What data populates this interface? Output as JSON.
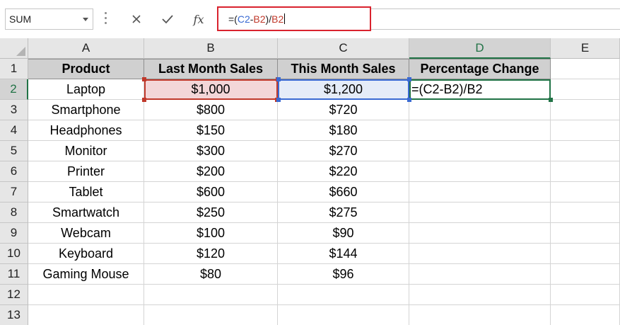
{
  "formula_bar": {
    "name_box": "SUM",
    "cancel_icon": "close-icon",
    "enter_icon": "check-icon",
    "fx_label": "fx",
    "formula_prefix": "=(",
    "formula_ref_c": "C2",
    "formula_minus": "-",
    "formula_ref_b": "B2",
    "formula_mid": ")/",
    "formula_ref_b2": "B2"
  },
  "columns": [
    "A",
    "B",
    "C",
    "D",
    "E"
  ],
  "rows": [
    "1",
    "2",
    "3",
    "4",
    "5",
    "6",
    "7",
    "8",
    "9",
    "10",
    "11",
    "12",
    "13"
  ],
  "headers": [
    "Product",
    "Last Month Sales",
    "This Month Sales",
    "Percentage Change"
  ],
  "data": [
    [
      "Laptop",
      "$1,000",
      "$1,200",
      "=(C2-B2)/B2"
    ],
    [
      "Smartphone",
      "$800",
      "$720",
      ""
    ],
    [
      "Headphones",
      "$150",
      "$180",
      ""
    ],
    [
      "Monitor",
      "$300",
      "$270",
      ""
    ],
    [
      "Printer",
      "$200",
      "$220",
      ""
    ],
    [
      "Tablet",
      "$600",
      "$660",
      ""
    ],
    [
      "Smartwatch",
      "$250",
      "$275",
      ""
    ],
    [
      "Webcam",
      "$100",
      "$90",
      ""
    ],
    [
      "Keyboard",
      "$120",
      "$144",
      ""
    ],
    [
      "Gaming Mouse",
      "$80",
      "$96",
      ""
    ]
  ],
  "colors": {
    "accent": "#217346",
    "ref_b": "#c0392b",
    "ref_c": "#3a6ad3",
    "formula_highlight": "#d9232e"
  }
}
